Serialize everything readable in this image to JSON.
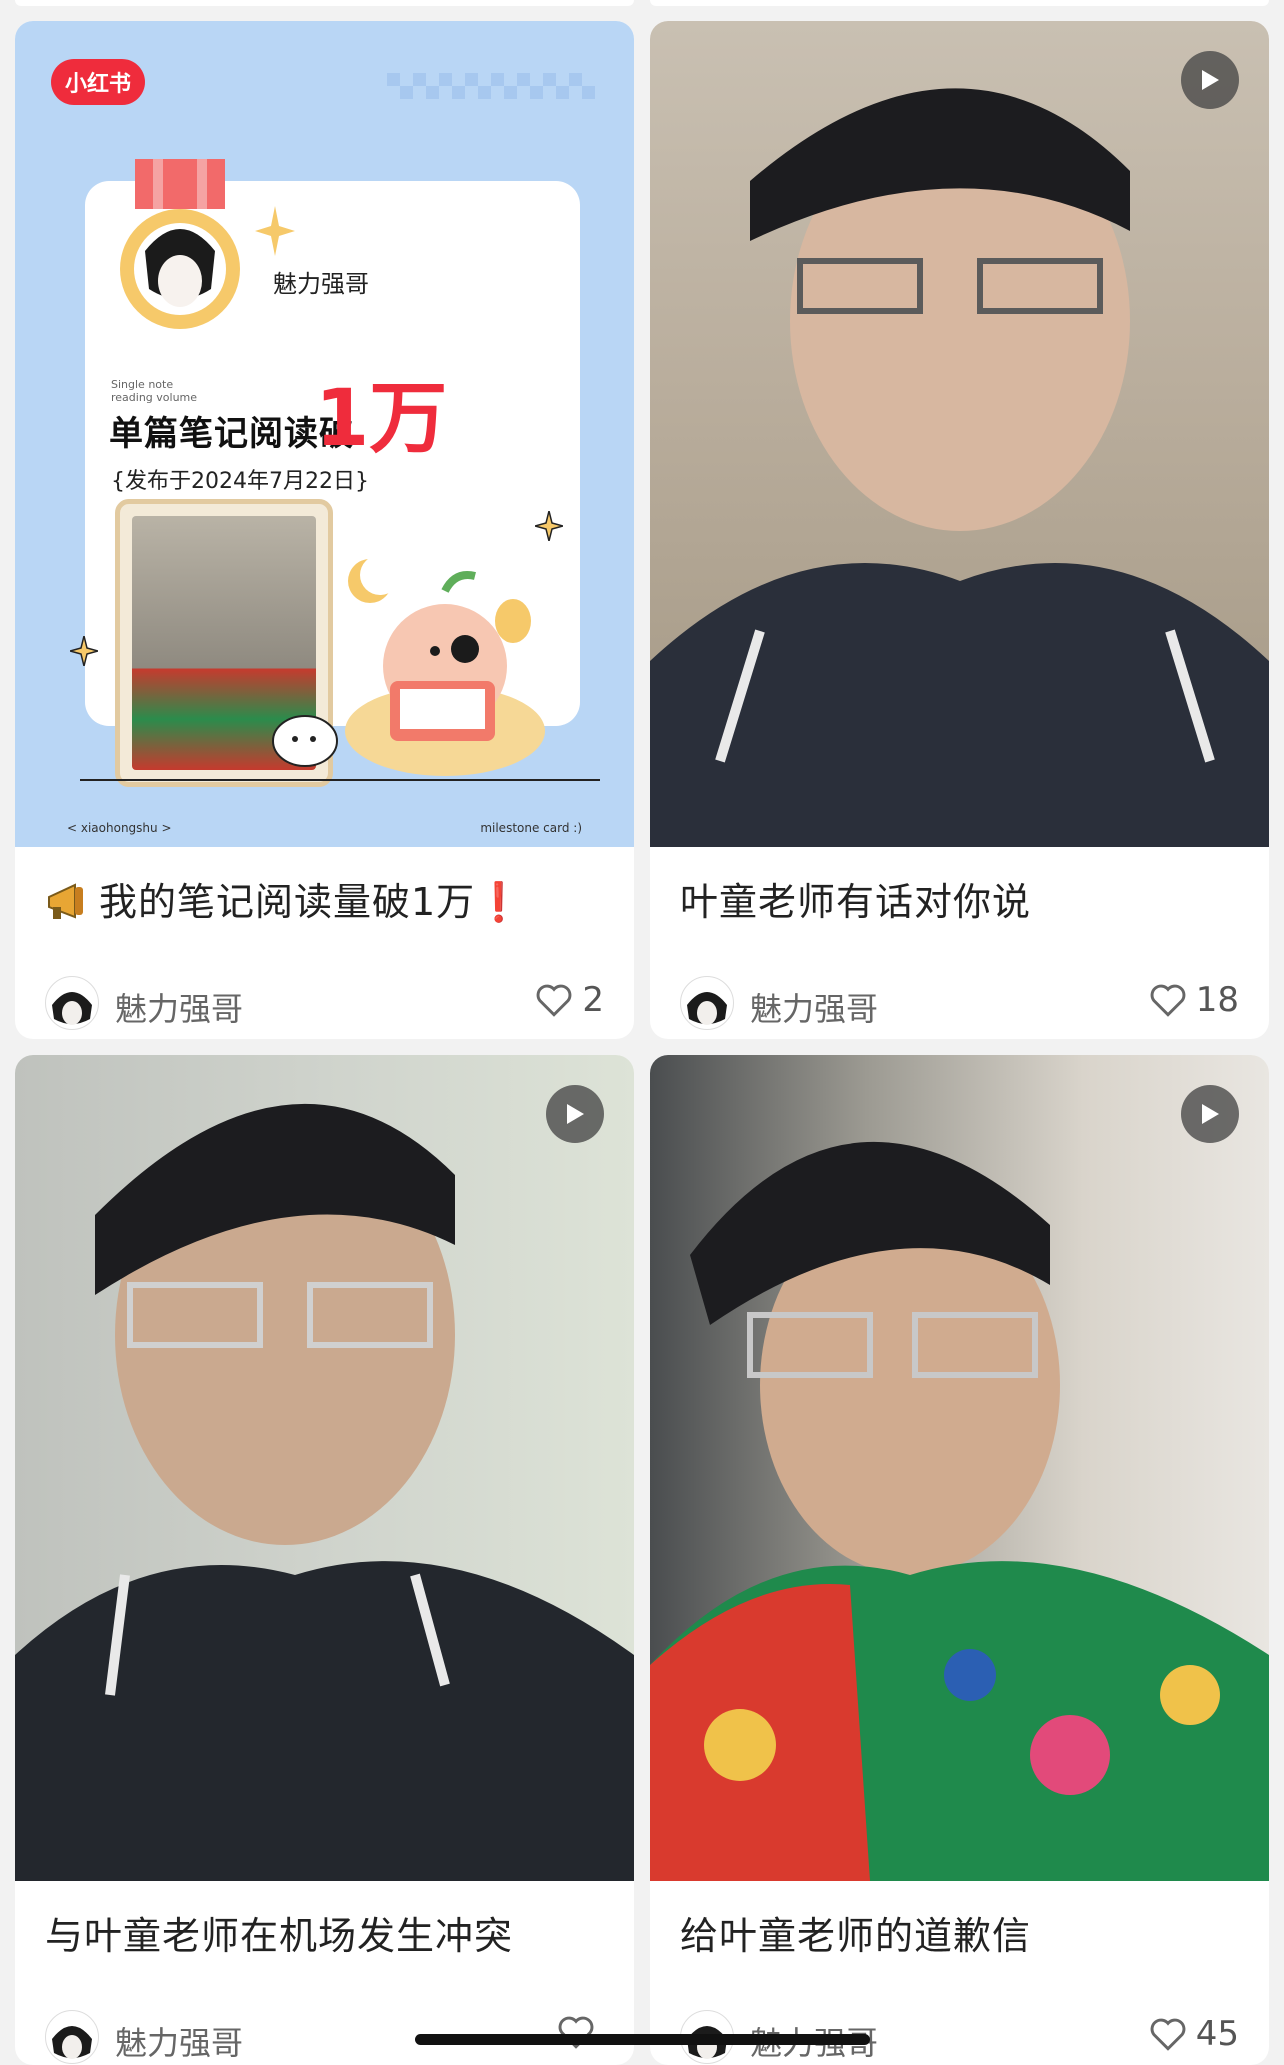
{
  "cards": [
    {
      "title_prefix_icon": "megaphone-icon",
      "title": "我的笔记阅读量破1万",
      "title_suffix": "❗",
      "author": "魅力强哥",
      "likes": "2",
      "is_video": false,
      "milestone": {
        "brand": "小红书",
        "name": "魅力强哥",
        "small_line1": "Single note",
        "small_line2": "reading volume",
        "big_text": "单篇笔记阅读破",
        "number": "1万",
        "date": "{发布于2024年7月22日}",
        "footer_left": "< xiaohongshu >",
        "footer_right": "milestone card :)"
      }
    },
    {
      "title": "叶童老师有话对你说",
      "author": "魅力强哥",
      "likes": "18",
      "is_video": true
    },
    {
      "title": "与叶童老师在机场发生冲突",
      "author": "魅力强哥",
      "likes": "",
      "is_video": true
    },
    {
      "title": "给叶童老师的道歉信",
      "author": "魅力强哥",
      "likes": "45",
      "is_video": true
    }
  ],
  "colors": {
    "brand_red": "#ef2c3c",
    "card_bg": "#ffffff",
    "page_bg": "#f2f2f2"
  }
}
